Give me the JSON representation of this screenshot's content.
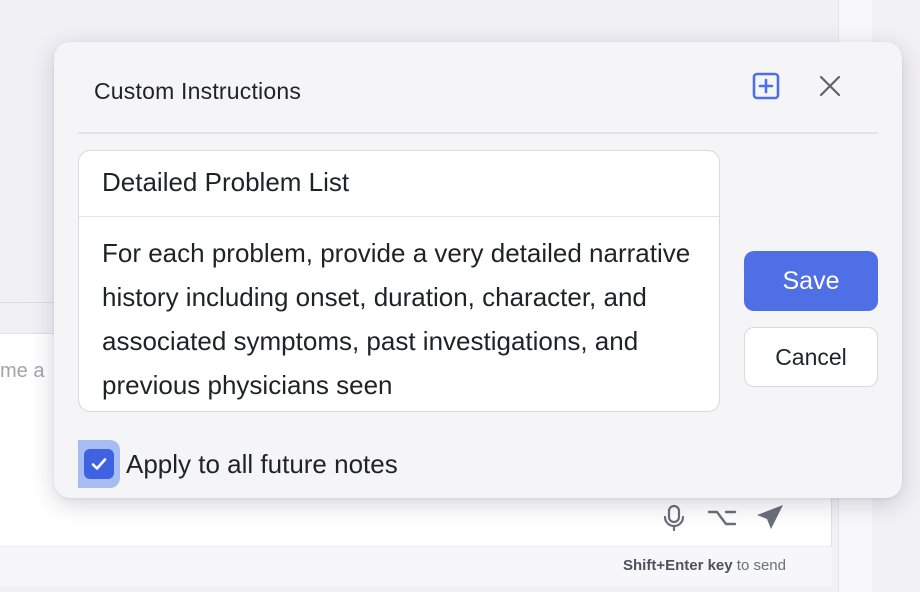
{
  "background": {
    "compose_placeholder": "me a",
    "hint_key": "Shift+Enter key",
    "hint_suffix": "to send",
    "icons": [
      "microphone-icon",
      "option-key-icon",
      "send-icon"
    ]
  },
  "modal": {
    "title": "Custom Instructions",
    "editor": {
      "title_value": "Detailed Problem List",
      "body_value": "For each problem, provide a very detailed narrative history including onset, duration, character, and associated symptoms, past investigations, and previous physicians seen"
    },
    "save_label": "Save",
    "cancel_label": "Cancel",
    "apply_all": {
      "label": "Apply to all future notes",
      "checked": true
    }
  },
  "colors": {
    "accent": "#4e6fe6",
    "checkbox": "#3f63e0",
    "modal_bg": "#f5f5f7"
  }
}
